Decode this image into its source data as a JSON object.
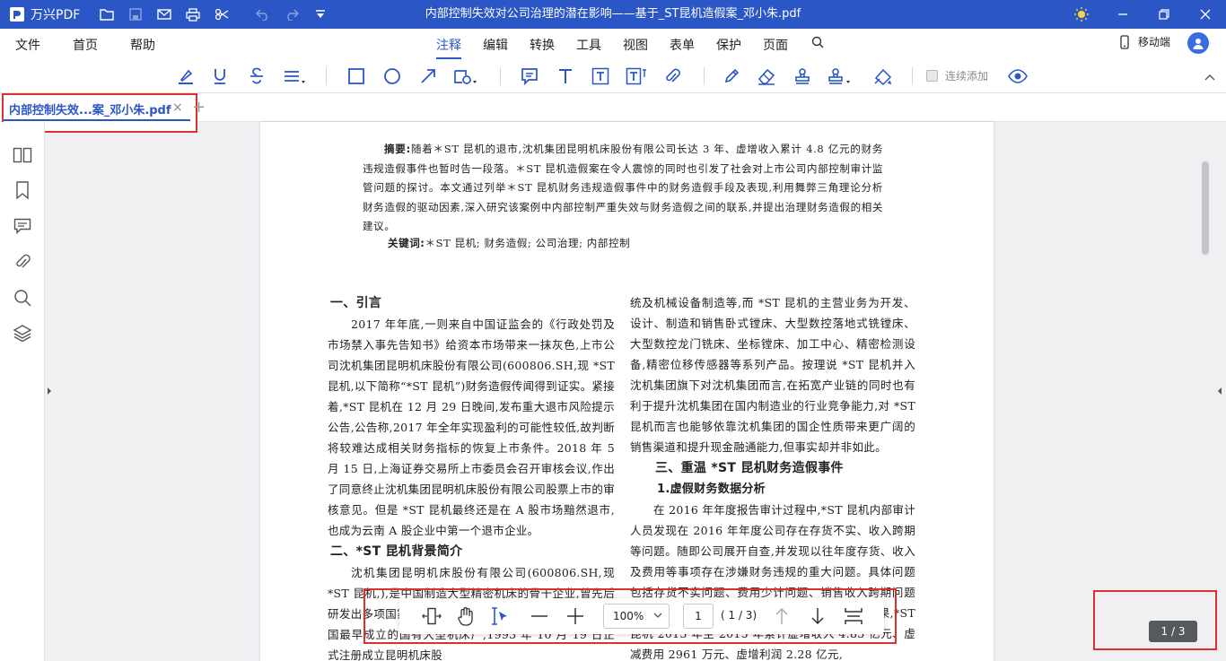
{
  "app": {
    "name": "万兴PDF",
    "document_title": "内部控制失效对公司治理的潜在影响——基于_ST昆机造假案_邓小朱.pdf"
  },
  "menu": {
    "left": [
      "文件",
      "首页",
      "帮助"
    ],
    "center": [
      "注释",
      "编辑",
      "转换",
      "工具",
      "视图",
      "表单",
      "保护",
      "页面"
    ],
    "active": "注释",
    "mobile_label": "移动端"
  },
  "toolbar": {
    "tools": [
      "highlight-icon",
      "underline-icon",
      "strikethrough-icon",
      "line-style-icon",
      "rectangle-icon",
      "circle-icon",
      "arrow-icon",
      "shape-icon",
      "note-icon",
      "text-icon",
      "textbox-icon",
      "text-callout-icon",
      "attachment-icon",
      "pencil-icon",
      "eraser-icon",
      "stamp-icon",
      "signature-icon",
      "measure-icon",
      "eye-icon"
    ],
    "continuous_add_label": "连续添加"
  },
  "tab": {
    "label": "内部控制失效...案_邓小朱.pdf",
    "close": "×",
    "add": "+"
  },
  "sidebar": {
    "icons": [
      "thumbnails-icon",
      "bookmark-icon",
      "comment-icon",
      "attachment-icon",
      "search-icon",
      "layers-icon"
    ]
  },
  "document": {
    "abstract_label": "摘要:",
    "abstract_text": "随着＊ST 昆机的退市,沈机集团昆明机床股份有限公司长达 3 年、虚增收入累计 4.8 亿元的财务违规造假事件也暂时告一段落。＊ST 昆机造假案在令人震惊的同时也引发了社会对上市公司内部控制审计监管问题的探讨。本文通过列举＊ST 昆机财务违规造假事件中的财务造假手段及表现,利用舞弊三角理论分析财务造假的驱动因素,深入研究该案例中内部控制严重失效与财务造假之间的联系,并提出治理财务造假的相关建议。",
    "keywords_label": "关键词:",
    "keywords_text": "＊ST 昆机; 财务造假; 公司治理; 内部控制",
    "left_column": {
      "h1": "一、引言",
      "p1": "2017 年年底,一则来自中国证监会的《行政处罚及市场禁入事先告知书》给资本市场带来一抹灰色,上市公司沈机集团昆明机床股份有限公司(600806.SH,现 *ST 昆机,以下简称“*ST 昆机”)财务造假传闻得到证实。紧接着,*ST 昆机在 12 月 29 日晚间,发布重大退市风险提示公告,公告称,2017 年全年实现盈利的可能性较低,故判断将较难达成相关财务指标的恢复上市条件。2018 年 5 月 15 日,上海证券交易所上市委员会召开审核会议,作出了同意终止沈机集团昆明机床股份有限公司股票上市的审核意见。但是 *ST 昆机最终还是在 A 股市场黯然退市,也成为云南 A 股企业中第一个退市企业。",
      "h2": "二、*ST 昆机背景简介",
      "p2": "沈机集团昆明机床股份有限公司(600806.SH,现 *ST 昆机,),是中国制造大型精密机床的骨干企业,曾先后研发出多项国家级重点新产品,公司始建于 1936 年,是我国最早成立的国有大型机床厂,1993 年 10 月 19 日正式注册成立昆明机床股"
    },
    "right_column": {
      "p1": "统及机械设备制造等,而 *ST 昆机的主营业务为开发、设计、制造和销售卧式镗床、大型数控落地式铣镗床、大型数控龙门铣床、坐标镗床、加工中心、精密检测设备,精密位移传感器等系列产品。按理说 *ST 昆机并入沈机集团旗下对沈机集团而言,在拓宽产业链的同时也有利于提升沈机集团在国内制造业的行业竞争能力,对 *ST 昆机而言也能够依靠沈机集团的国企性质带来更广阔的销售渠道和提升现金融通能力,但事实却并非如此。",
      "h1": "三、重温 *ST 昆机财务造假事件",
      "h2": "1.虚假财务数据分析",
      "p2": "在 2016 年年度报告审计过程中,*ST 昆机内部审计人员发现在 2016 年年度公司存在存货不实、收入跨期等问题。随即公司展开自查,并发现以往年度存货、收入及费用等事项存在涉嫌财务违规的重大问题。具体问题包括存货不实问题、费用少计问题、销售收入跨期问题以及未按规定披露关联交易等,根据证监会调查结果,*ST 昆机 2013 年至 2015 年累计虚增收入 4.83 亿元、虚减费用 2961 万元、虚增利润 2.28 亿元,"
    }
  },
  "bottom_toolbar": {
    "zoom": "100%",
    "page_input": "1",
    "page_total": "( 1 / 3)",
    "icons": [
      "fit-width-icon",
      "hand-icon",
      "select-text-icon",
      "zoom-out-icon",
      "zoom-in-icon",
      "page-up-icon",
      "page-down-icon",
      "fit-page-icon"
    ]
  },
  "page_indicator": "1 / 3",
  "colors": {
    "brand": "#2a56c6",
    "highlight_box": "#e0302e"
  }
}
